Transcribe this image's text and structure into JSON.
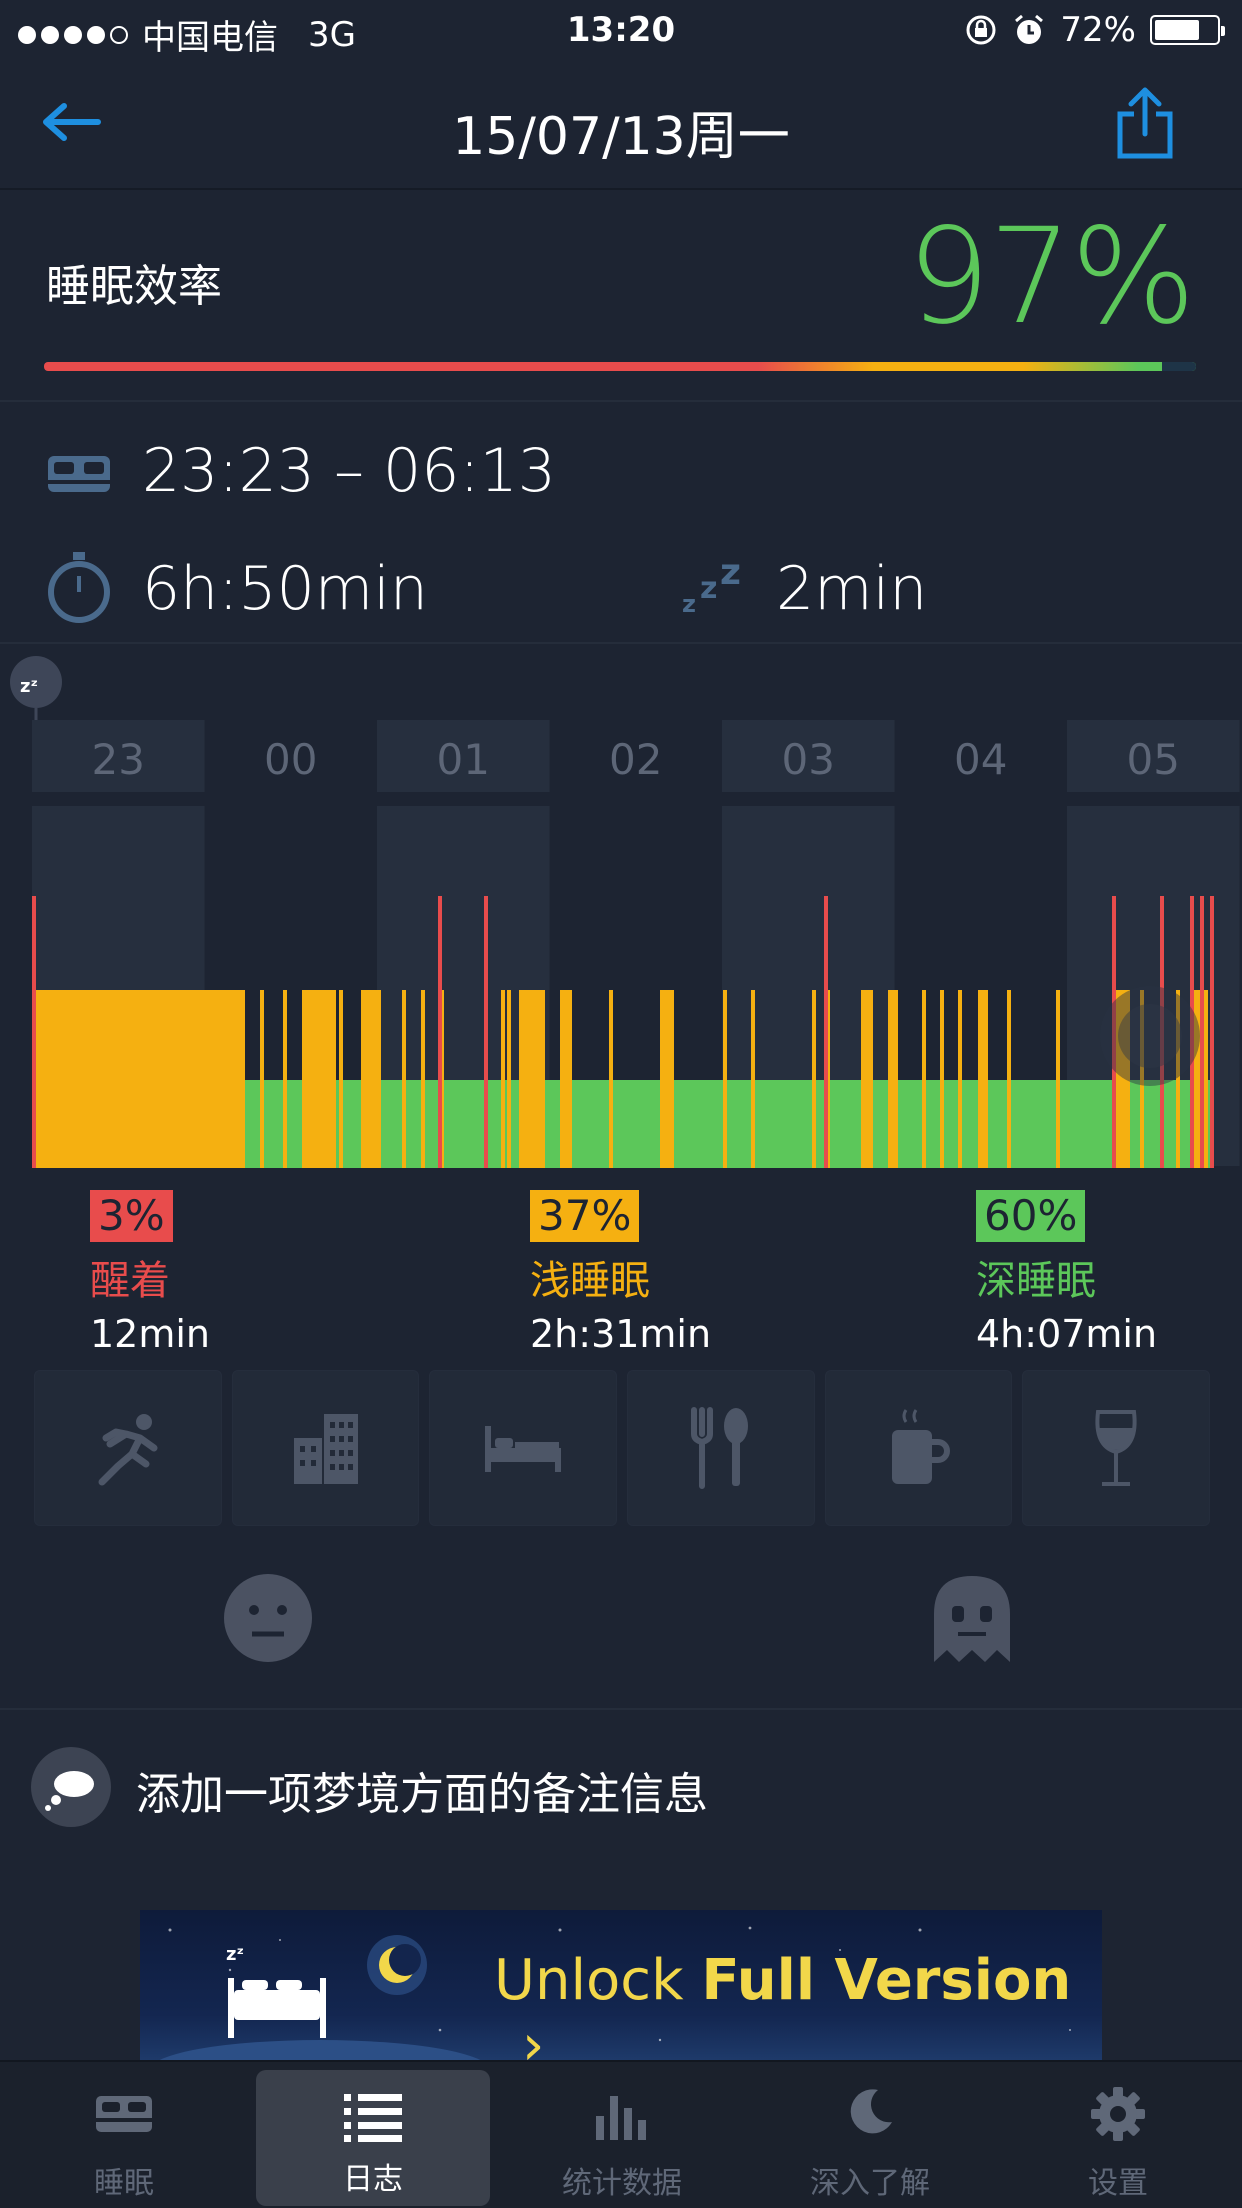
{
  "status_bar": {
    "carrier": "中国电信",
    "network": "3G",
    "time": "13:20",
    "battery": "72%"
  },
  "nav": {
    "title": "15/07/13周一"
  },
  "efficiency": {
    "label": "睡眠效率",
    "value": "97%",
    "value_fraction": 0.97
  },
  "times": {
    "bed_range": "23:23 – 06:13",
    "duration": "6h:50min",
    "fall_asleep": "2min"
  },
  "chart": {
    "hours": [
      "23",
      "00",
      "01",
      "02",
      "03",
      "04",
      "05"
    ]
  },
  "legend": [
    {
      "percent": "3%",
      "name": "醒着",
      "duration": "12min",
      "color": "#e84c4c"
    },
    {
      "percent": "37%",
      "name": "浅睡眠",
      "duration": "2h:31min",
      "color": "#f5b011"
    },
    {
      "percent": "60%",
      "name": "深睡眠",
      "duration": "4h:07min",
      "color": "#5cc75a"
    }
  ],
  "tags": [
    "running-icon",
    "building-icon",
    "bed-icon",
    "fork-spoon-icon",
    "coffee-icon",
    "wine-icon"
  ],
  "dream": {
    "text": "添加一项梦境方面的备注信息"
  },
  "banner": {
    "text_normal": "Unlock ",
    "text_bold": "Full Version",
    "arrow": "›"
  },
  "tabbar": [
    {
      "label": "睡眠",
      "icon": "bed-icon",
      "active": false
    },
    {
      "label": "日志",
      "icon": "list-icon",
      "active": true
    },
    {
      "label": "统计数据",
      "icon": "bar-chart-icon",
      "active": false
    },
    {
      "label": "深入了解",
      "icon": "moon-icon",
      "active": false
    },
    {
      "label": "设置",
      "icon": "gear-icon",
      "active": false
    }
  ],
  "colors": {
    "awake": "#e84c4c",
    "light": "#f5b011",
    "deep": "#5cc75a",
    "accent": "#1e8fe0"
  }
}
